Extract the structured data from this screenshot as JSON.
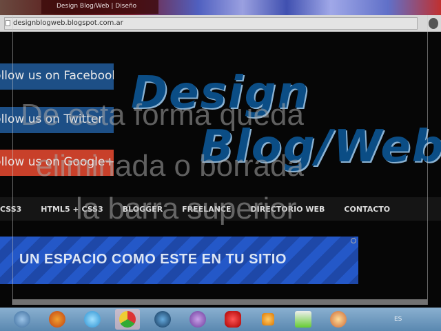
{
  "browser": {
    "tab_title": "Design Blog/Web | Diseño",
    "url": "designblogweb.blogspot.com.ar"
  },
  "social": {
    "facebook": "Follow us on Facebook",
    "twitter": "Follow us on Twitter",
    "google": "Follow us on Google+"
  },
  "logo": {
    "line1": "Design",
    "line2": "Blog/Web"
  },
  "overlay": {
    "line1": "De esta forma queda",
    "line2": "eliminada o borrada",
    "line3": "la barra superior"
  },
  "nav": {
    "items": [
      "CSS3",
      "HTML5 + CSS3",
      "BLOGGER",
      "FREELANCE",
      "DIRECTORIO WEB",
      "CONTACTO"
    ]
  },
  "ad": {
    "text": "UN ESPACIO COMO ESTE EN TU SITIO"
  },
  "taskbar": {
    "apps": [
      "windows-start",
      "firefox",
      "internet-explorer",
      "chrome",
      "app-a",
      "app-purple",
      "pokerstars",
      "media-player",
      "chart-app",
      "film-reel"
    ],
    "lang": "ES"
  },
  "colors": {
    "social_blue": "#1d4f86",
    "social_red": "#c8402a",
    "logo": "#0b4d85",
    "ad": "#2458c8"
  }
}
